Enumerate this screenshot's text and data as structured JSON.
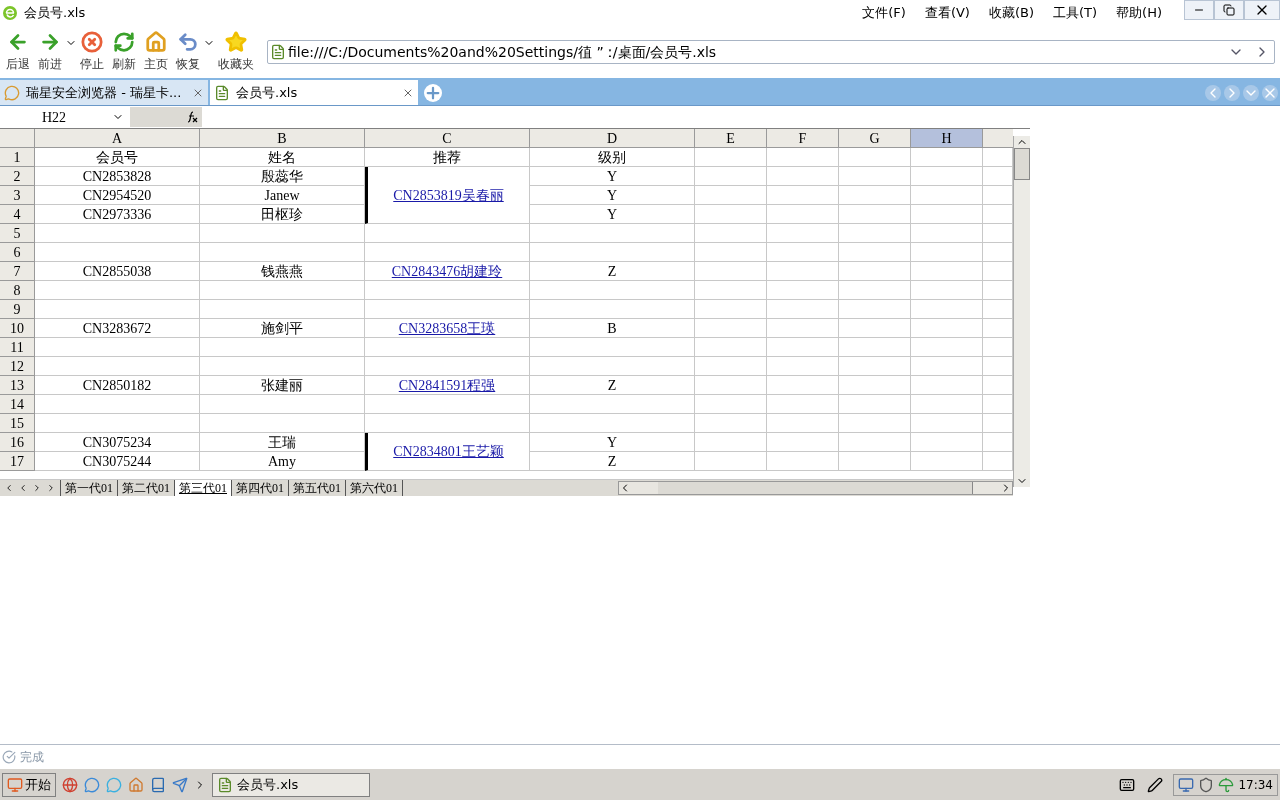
{
  "window": {
    "title": "会员号.xls"
  },
  "menu": [
    "文件(F)",
    "查看(V)",
    "收藏(B)",
    "工具(T)",
    "帮助(H)"
  ],
  "toolbar": [
    {
      "kind": "back",
      "label": "后退",
      "dropdown": false
    },
    {
      "kind": "forward",
      "label": "前进",
      "dropdown": true
    },
    {
      "kind": "stop",
      "label": "停止",
      "dropdown": false
    },
    {
      "kind": "refresh",
      "label": "刷新",
      "dropdown": false
    },
    {
      "kind": "home",
      "label": "主页",
      "dropdown": false
    },
    {
      "kind": "restore",
      "label": "恢复",
      "dropdown": true
    },
    {
      "kind": "favorites",
      "label": "收藏夹",
      "dropdown": false
    }
  ],
  "address": {
    "value": "file:///C:/Documents%20and%20Settings/徝 ” ː/桌面/会员号.xls"
  },
  "tabs": [
    {
      "label": "瑞星安全浏览器 - 瑞星卡...",
      "selected": false
    },
    {
      "label": "会员号.xls",
      "selected": true
    }
  ],
  "spreadsheet": {
    "name_box": "H22",
    "columns": [
      {
        "label": "A",
        "selected": false
      },
      {
        "label": "B",
        "selected": false
      },
      {
        "label": "C",
        "selected": false
      },
      {
        "label": "D",
        "selected": false
      },
      {
        "label": "E",
        "selected": false
      },
      {
        "label": "F",
        "selected": false
      },
      {
        "label": "G",
        "selected": false
      },
      {
        "label": "H",
        "selected": true
      }
    ],
    "rows": [
      {
        "kind": "header",
        "row": "1",
        "cells": [
          "会员号",
          "姓名",
          "推荐",
          "级别"
        ]
      },
      {
        "kind": "group",
        "referrer": "CN2853819吴春丽",
        "bordered": true,
        "members": [
          {
            "row": "2",
            "id": "CN2853828",
            "name": "殷蕊华",
            "level": "Y"
          },
          {
            "row": "3",
            "id": "CN2954520",
            "name": "Janew",
            "level": "Y"
          },
          {
            "row": "4",
            "id": "CN2973336",
            "name": "田枢珍",
            "level": "Y"
          }
        ]
      },
      {
        "kind": "blank",
        "row": "5"
      },
      {
        "kind": "blank",
        "row": "6"
      },
      {
        "kind": "group",
        "referrer": "CN2843476胡建玲",
        "bordered": false,
        "members": [
          {
            "row": "7",
            "id": "CN2855038",
            "name": "钱燕燕",
            "level": "Z"
          }
        ]
      },
      {
        "kind": "blank",
        "row": "8"
      },
      {
        "kind": "blank",
        "row": "9"
      },
      {
        "kind": "group",
        "referrer": "CN3283658王瑛",
        "bordered": false,
        "members": [
          {
            "row": "10",
            "id": "CN3283672",
            "name": "施剑平",
            "level": "B"
          }
        ]
      },
      {
        "kind": "blank",
        "row": "11"
      },
      {
        "kind": "blank",
        "row": "12"
      },
      {
        "kind": "group",
        "referrer": "CN2841591程强",
        "bordered": false,
        "members": [
          {
            "row": "13",
            "id": "CN2850182",
            "name": "张建丽",
            "level": "Z"
          }
        ]
      },
      {
        "kind": "blank",
        "row": "14"
      },
      {
        "kind": "blank",
        "row": "15"
      },
      {
        "kind": "group",
        "referrer": "CN2834801王艺颖",
        "bordered": true,
        "members": [
          {
            "row": "16",
            "id": "CN3075234",
            "name": "王瑞",
            "level": "Y"
          },
          {
            "row": "17",
            "id": "CN3075244",
            "name": "Amy",
            "level": "Z"
          }
        ]
      }
    ],
    "sheets": [
      {
        "label": "第一代01",
        "selected": false
      },
      {
        "label": "第二代01",
        "selected": false
      },
      {
        "label": "第三代01",
        "selected": true
      },
      {
        "label": "第四代01",
        "selected": false
      },
      {
        "label": "第五代01",
        "selected": false
      },
      {
        "label": "第六代01",
        "selected": false
      }
    ]
  },
  "status_bar": {
    "text": "完成"
  },
  "taskbar": {
    "start": "开始",
    "windows": [
      {
        "label": "会员号.xls",
        "selected": true
      }
    ],
    "clock": "17:34"
  }
}
